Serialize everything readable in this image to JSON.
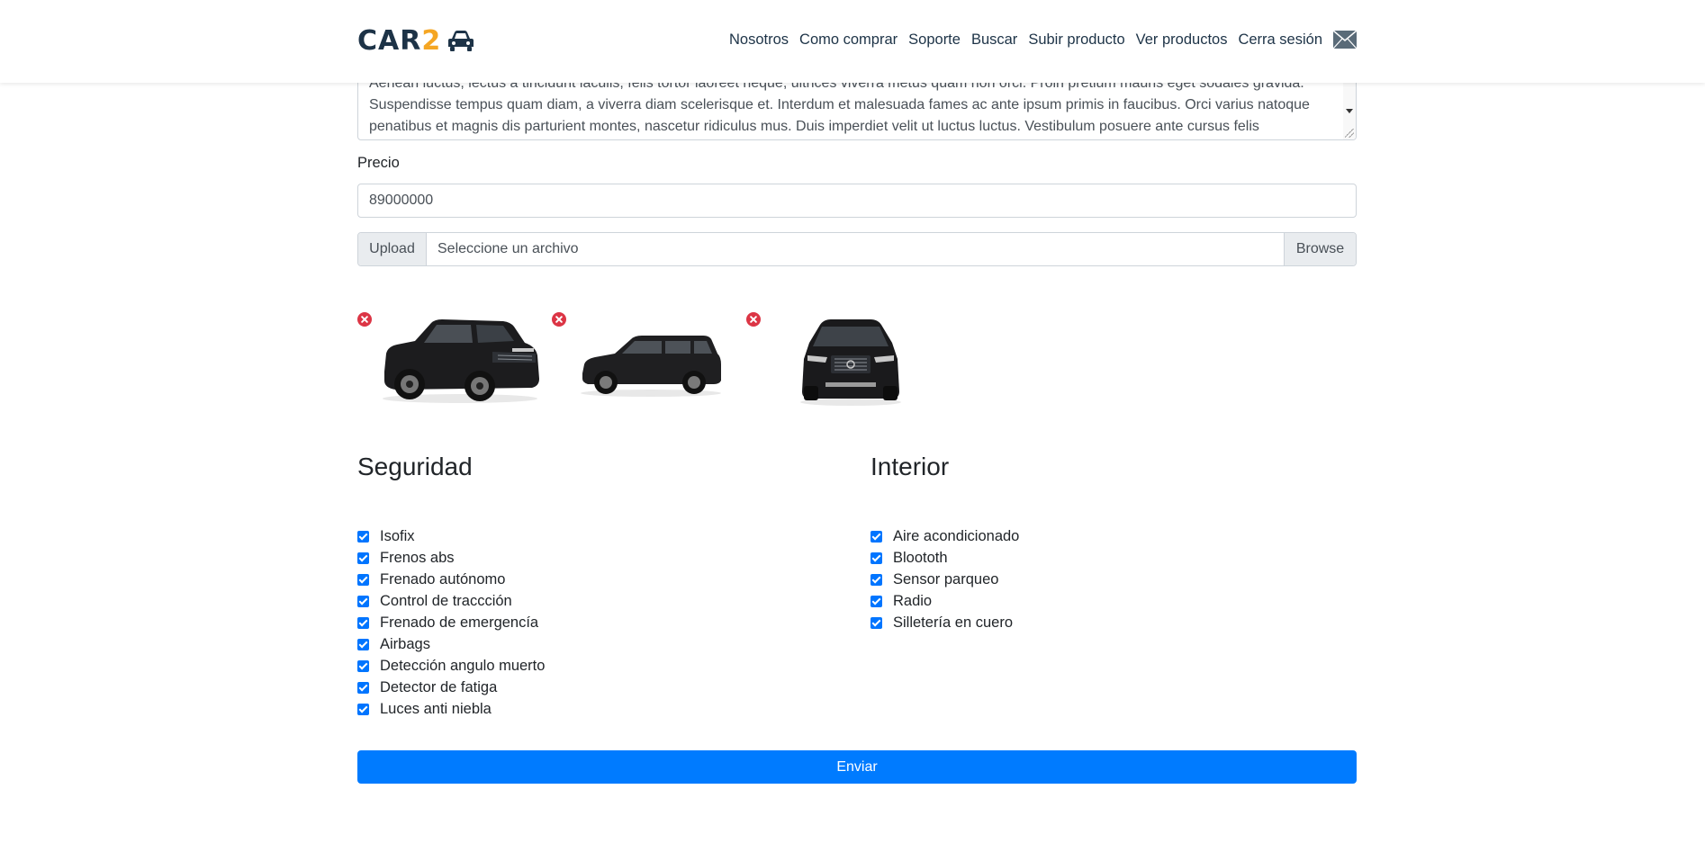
{
  "brand": {
    "text_main": "CAR",
    "text_accent": "2"
  },
  "nav": {
    "links": [
      "Nosotros",
      "Como comprar",
      "Soporte",
      "Buscar",
      "Subir producto",
      "Ver productos",
      "Cerra sesión"
    ]
  },
  "form": {
    "description_text": "Aenean luctus, lectus a tincidunt iaculis, felis tortor laoreet neque, ultrices viverra metus quam non orci. Proin pretium mauris eget sodales gravida. Suspendisse tempus quam diam, a viverra diam scelerisque et. Interdum et malesuada fames ac ante ipsum primis in faucibus. Orci varius natoque penatibus et magnis dis parturient montes, nascetur ridiculus mus. Duis imperdiet velit ut luctus luctus. Vestibulum posuere ante cursus felis consectetur, et semper odio.",
    "price_label": "Precio",
    "price_value": "89000000",
    "upload_prepend": "Upload",
    "upload_label": "Seleccione un archivo",
    "upload_browse": "Browse",
    "images": [
      "car-photo-3quarter",
      "car-photo-side",
      "car-photo-front"
    ],
    "submit_label": "Enviar"
  },
  "seguridad": {
    "title": "Seguridad",
    "items": [
      "Isofix",
      "Frenos abs",
      "Frenado autónomo",
      "Control de traccción",
      "Frenado de emergencía",
      "Airbags",
      "Detección angulo muerto",
      "Detector de fatiga",
      "Luces anti niebla"
    ]
  },
  "interior": {
    "title": "Interior",
    "items": [
      "Aire acondicionado",
      "Bloototh",
      "Sensor parqueo",
      "Radio",
      "Silletería en cuero"
    ]
  },
  "colors": {
    "primary": "#007bff",
    "brand_dark": "#1d3347",
    "brand_accent": "#f5a623",
    "remove": "#dc3545"
  }
}
